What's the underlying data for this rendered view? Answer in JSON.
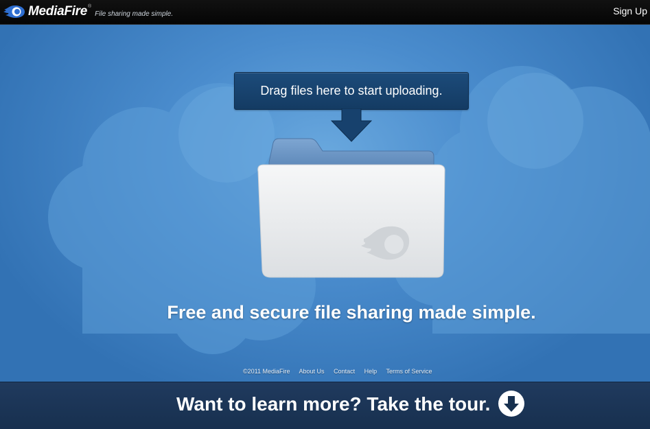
{
  "header": {
    "brand": "MediaFire",
    "registered_mark": "®",
    "tagline": "File sharing made simple.",
    "signup_label": "Sign Up"
  },
  "upload": {
    "tooltip": "Drag files here to start uploading."
  },
  "main": {
    "headline": "Free and secure file sharing made simple."
  },
  "footer": {
    "copyright": "©2011 MediaFire",
    "links": [
      "About Us",
      "Contact",
      "Help",
      "Terms of Service"
    ]
  },
  "tour": {
    "text": "Want to learn more? Take the tour.",
    "icon": "arrow-down-circle-icon"
  },
  "colors": {
    "topbar": "#0a0a0a",
    "stage": "#4a8ccd",
    "tooltip": "#17416d",
    "tourbar": "#1b3456"
  }
}
